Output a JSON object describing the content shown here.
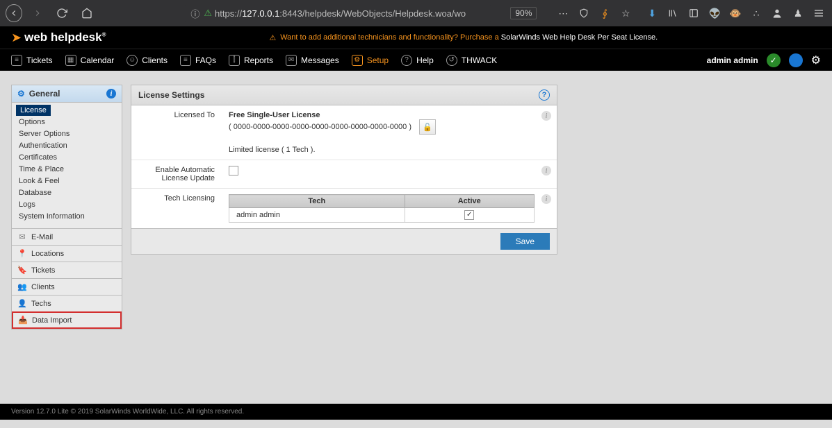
{
  "browser": {
    "url_prefix": "https://",
    "url_host": "127.0.0.1",
    "url_path": ":8443/helpdesk/WebObjects/Helpdesk.woa/wo",
    "zoom": "90%"
  },
  "logo": {
    "text": "web helpdesk"
  },
  "promo": {
    "cta": "Want to add additional technicians and functionality? Purchase a ",
    "product": "SolarWinds Web Help Desk Per Seat License."
  },
  "nav": {
    "items": [
      "Tickets",
      "Calendar",
      "Clients",
      "FAQs",
      "Reports",
      "Messages",
      "Setup",
      "Help",
      "THWACK"
    ],
    "user": "admin admin"
  },
  "sidebar": {
    "head": "General",
    "items": [
      "License",
      "Options",
      "Server Options",
      "Authentication",
      "Certificates",
      "Time & Place",
      "Look & Feel",
      "Database",
      "Logs",
      "System Information"
    ],
    "cats": [
      "E-Mail",
      "Locations",
      "Tickets",
      "Clients",
      "Techs",
      "Data Import"
    ]
  },
  "panel": {
    "title": "License Settings",
    "rows": {
      "r0": {
        "label": "Licensed To",
        "val_title": "Free Single-User License",
        "val_serial": "( 0000-0000-0000-0000-0000-0000-0000-0000-0000 )",
        "val_note": "Limited license ( 1 Tech )."
      },
      "r1": {
        "label": "Enable Automatic License Update"
      },
      "r2": {
        "label": "Tech Licensing",
        "th0": "Tech",
        "th1": "Active",
        "td0": "admin admin"
      }
    },
    "save": "Save"
  },
  "footer": "Version 12.7.0 Lite © 2019 SolarWinds WorldWide, LLC. All rights reserved."
}
